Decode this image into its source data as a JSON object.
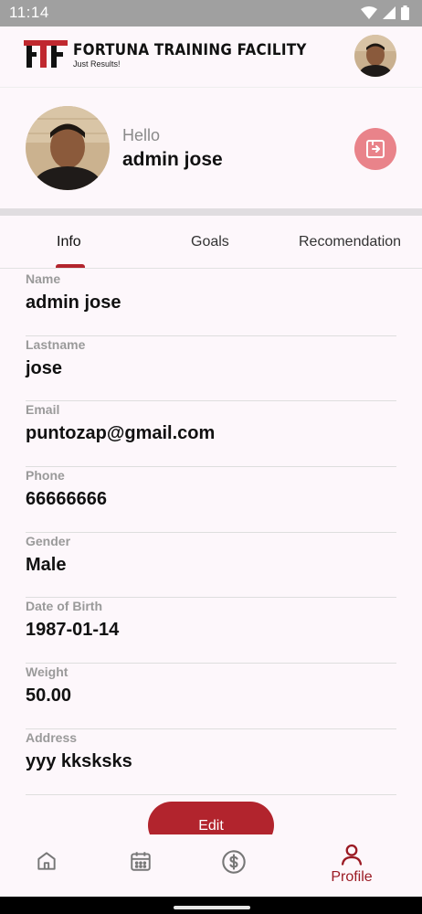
{
  "status": {
    "time": "11:14"
  },
  "header": {
    "brand_title": "FORTUNA TRAINING FACILITY",
    "brand_tagline": "Just Results!",
    "logo_letters": "FTF"
  },
  "profile": {
    "greeting": "Hello",
    "name": "admin jose"
  },
  "tabs": [
    {
      "label": "Info",
      "active": true
    },
    {
      "label": "Goals",
      "active": false
    },
    {
      "label": "Recomendation",
      "active": false
    }
  ],
  "fields": [
    {
      "label": "Name",
      "value": "admin jose"
    },
    {
      "label": "Lastname",
      "value": "jose"
    },
    {
      "label": "Email",
      "value": "puntozap@gmail.com"
    },
    {
      "label": "Phone",
      "value": "66666666"
    },
    {
      "label": "Gender",
      "value": "Male"
    },
    {
      "label": "Date of Birth",
      "value": "1987-01-14"
    },
    {
      "label": "Weight",
      "value": "50.00"
    },
    {
      "label": "Address",
      "value": "yyy kksksks"
    }
  ],
  "actions": {
    "edit_label": "Edit"
  },
  "nav": {
    "items": [
      {
        "icon": "home-icon"
      },
      {
        "icon": "calendar-icon"
      },
      {
        "icon": "dollar-icon"
      },
      {
        "icon": "person-icon",
        "label": "Profile",
        "active": true
      }
    ]
  },
  "colors": {
    "accent": "#b2242d",
    "logout": "#e9838a",
    "background": "#fdf7fb"
  }
}
